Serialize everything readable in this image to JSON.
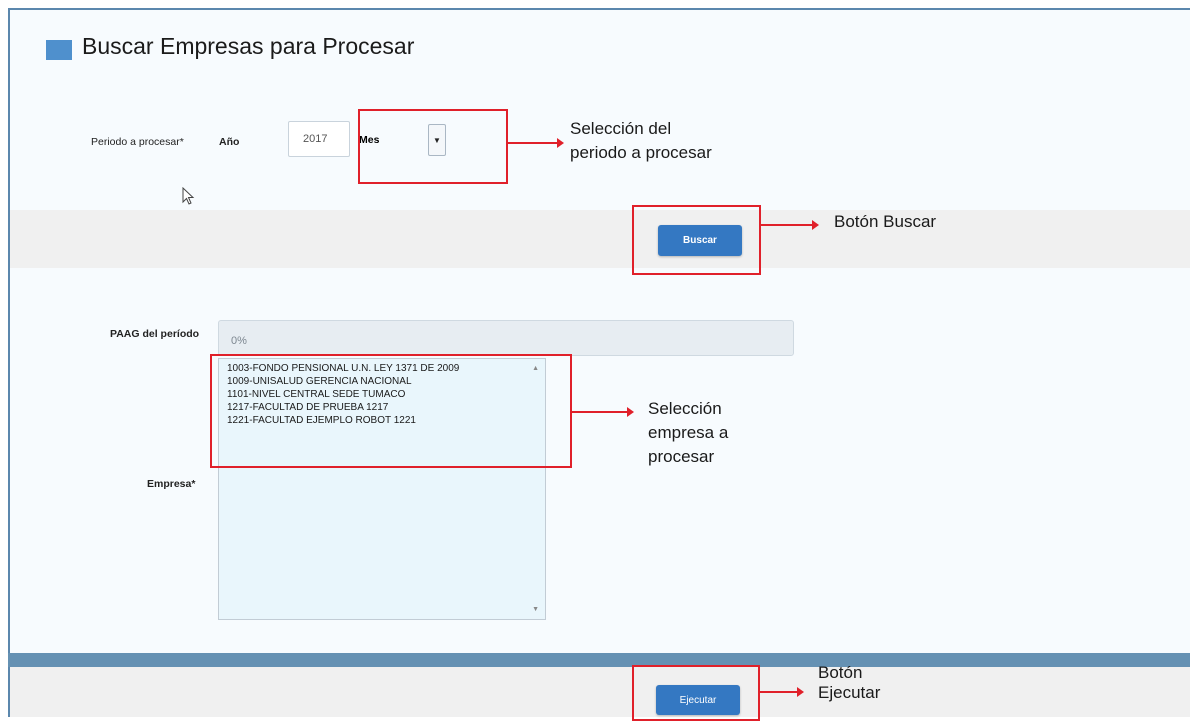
{
  "header": {
    "title": "Buscar Empresas para Procesar"
  },
  "period": {
    "label": "Periodo a procesar*",
    "year_label": "Año",
    "year_value": "2017",
    "month_label": "Mes",
    "month_dropdown_arrow": "▼"
  },
  "buttons": {
    "buscar": "Buscar",
    "ejecutar": "Ejecutar"
  },
  "paag": {
    "label": "PAAG del período",
    "value": "0%"
  },
  "empresa": {
    "label": "Empresa*",
    "items": [
      "1003-FONDO PENSIONAL U.N. LEY 1371 DE 2009",
      "1009-UNISALUD GERENCIA NACIONAL",
      "1101-NIVEL CENTRAL SEDE TUMACO",
      "1217-FACULTAD DE PRUEBA 1217",
      "1221-FACULTAD EJEMPLO ROBOT 1221"
    ]
  },
  "annotations": {
    "period_line1": "Selección del",
    "period_line2": "periodo a procesar",
    "buscar": "Botón Buscar",
    "empresa_line1": "Selección",
    "empresa_line2": "empresa a",
    "empresa_line3": "procesar",
    "ejecutar_line1": "Botón",
    "ejecutar_line2": "Ejecutar"
  },
  "colors": {
    "accent": "#4f90cd",
    "button": "#3478c2",
    "highlight_box": "#e0202a",
    "list_background": "#e9f6fc"
  }
}
